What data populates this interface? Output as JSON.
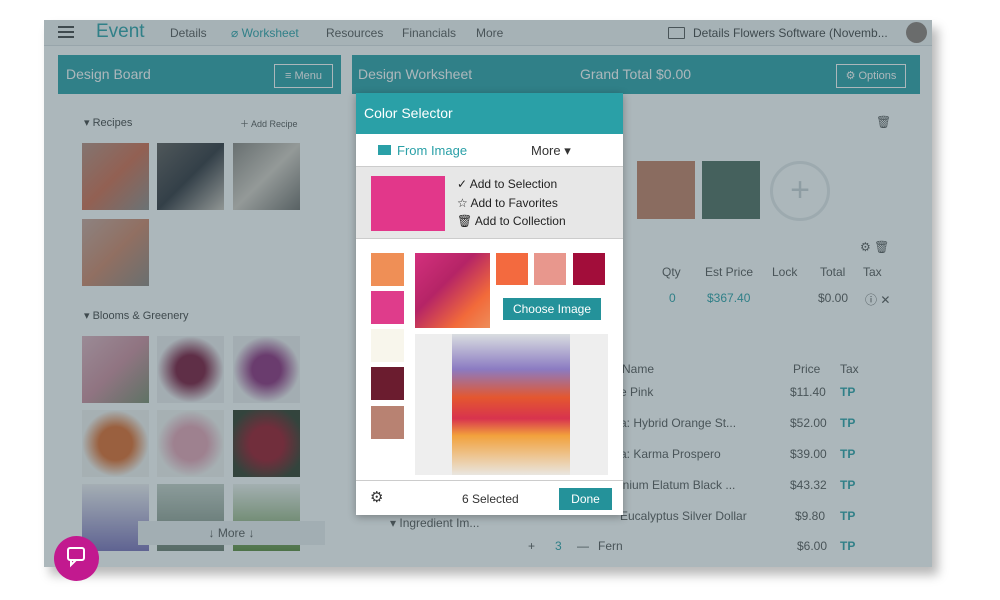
{
  "topbar": {
    "brand": "Event",
    "nav": [
      "Details",
      "Worksheet",
      "Resources",
      "Financials",
      "More"
    ],
    "active_tab": "Worksheet",
    "company": "Details Flowers Software (Novemb..."
  },
  "design_board": {
    "title": "Design Board",
    "menu_label": "Menu",
    "recipes_label": "Recipes",
    "add_recipe_label": "Add Recipe",
    "blooms_label": "Blooms & Greenery",
    "more_label": "More"
  },
  "worksheet": {
    "title": "Design Worksheet",
    "grand_total": "Grand Total  $0.00",
    "options_label": "Options",
    "columns": [
      "Qty",
      "Est Price",
      "Lock",
      "Total",
      "Tax"
    ],
    "row_qty": "0",
    "row_price": "$367.40",
    "row_total": "$0.00",
    "ing_headers": [
      "Name",
      "Price",
      "Tax"
    ],
    "ingredients": [
      {
        "name": "e Pink",
        "price": "$11.40",
        "tax": "TP"
      },
      {
        "name": "a: Hybrid Orange St...",
        "price": "$52.00",
        "tax": "TP"
      },
      {
        "name": "a: Karma Prospero",
        "price": "$39.00",
        "tax": "TP"
      },
      {
        "name": "inium Elatum Black ...",
        "price": "$43.32",
        "tax": "TP"
      },
      {
        "name": "Eucalyptus Silver Dollar",
        "price": "$9.80",
        "tax": "TP"
      },
      {
        "name": "Fern",
        "qty": "3",
        "price": "$6.00",
        "tax": "TP"
      }
    ],
    "ingredient_images_label": "Ingredient Im...",
    "swatch_colors": [
      "#c57f62",
      "#4f6c5e"
    ]
  },
  "color_selector": {
    "title": "Color Selector",
    "tab_from_image": "From Image",
    "tab_more": "More",
    "selected_color": "#e2378a",
    "actions": [
      "Add to Selection",
      "Add to Favorites",
      "Add to Collection"
    ],
    "palette_left": [
      "#ef8f56",
      "#df3c8b",
      "#f8f6ec",
      "#6b1c2f",
      "#b88272"
    ],
    "palette_top": [
      "#f36a3f",
      "#e8978d",
      "#a20d3a"
    ],
    "choose_image_label": "Choose Image",
    "selected_count": "6 Selected",
    "done_label": "Done"
  },
  "colors": {
    "accent": "#2aa0a7",
    "chat": "#c2198f"
  }
}
